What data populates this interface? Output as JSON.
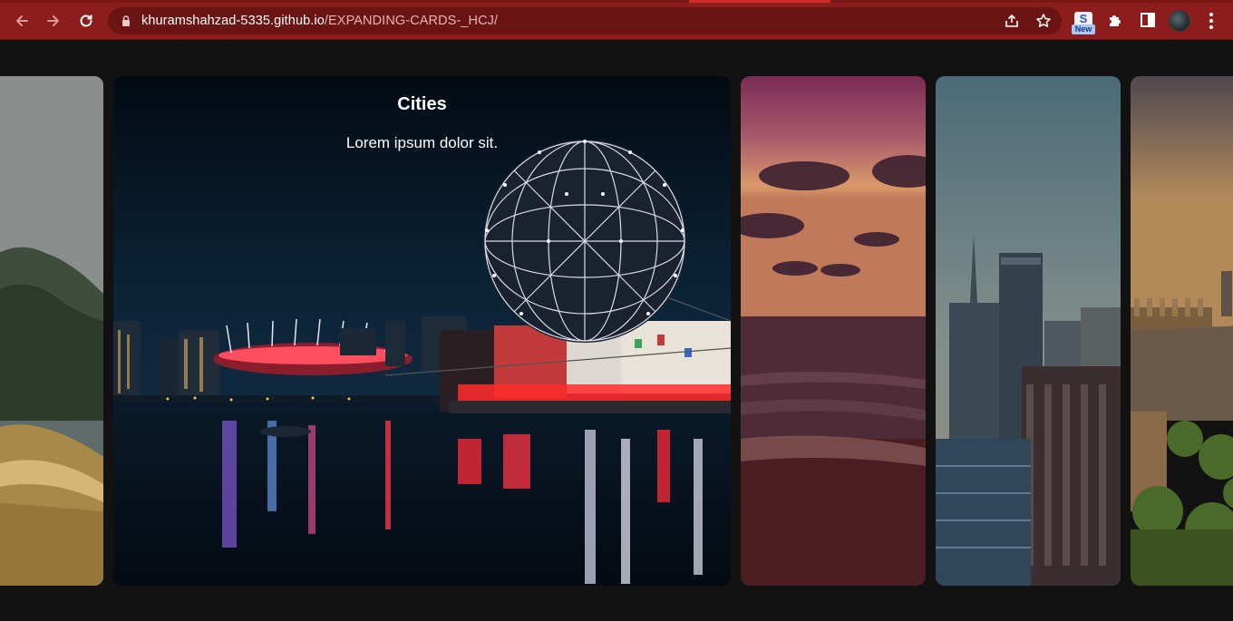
{
  "browser": {
    "url_host": "khuramshahzad-5335.github.io",
    "url_path": "/EXPANDING-CARDS-_HCJ/",
    "extension_badge": "New",
    "extension_letter": "S",
    "icons": [
      "back-arrow-icon",
      "forward-arrow-icon",
      "reload-icon",
      "lock-icon",
      "share-icon",
      "star-icon",
      "extension-s-icon",
      "puzzle-icon",
      "side-panel-icon",
      "profile-avatar",
      "kebab-menu-icon"
    ]
  },
  "cards": [
    {
      "title": "",
      "description": "",
      "scene": "mountain-lake-boat",
      "active": false
    },
    {
      "title": "Cities",
      "description": "Lorem ipsum dolor sit.",
      "scene": "city-night-dome",
      "active": true
    },
    {
      "title": "",
      "description": "",
      "scene": "sunset-beach",
      "active": false
    },
    {
      "title": "",
      "description": "",
      "scene": "city-skyscrapers",
      "active": false
    },
    {
      "title": "",
      "description": "",
      "scene": "ancient-ruins",
      "active": false
    }
  ],
  "colors": {
    "chrome": "#8d1d1d",
    "omnibox": "#6b1414",
    "page_bg": "#121212"
  }
}
